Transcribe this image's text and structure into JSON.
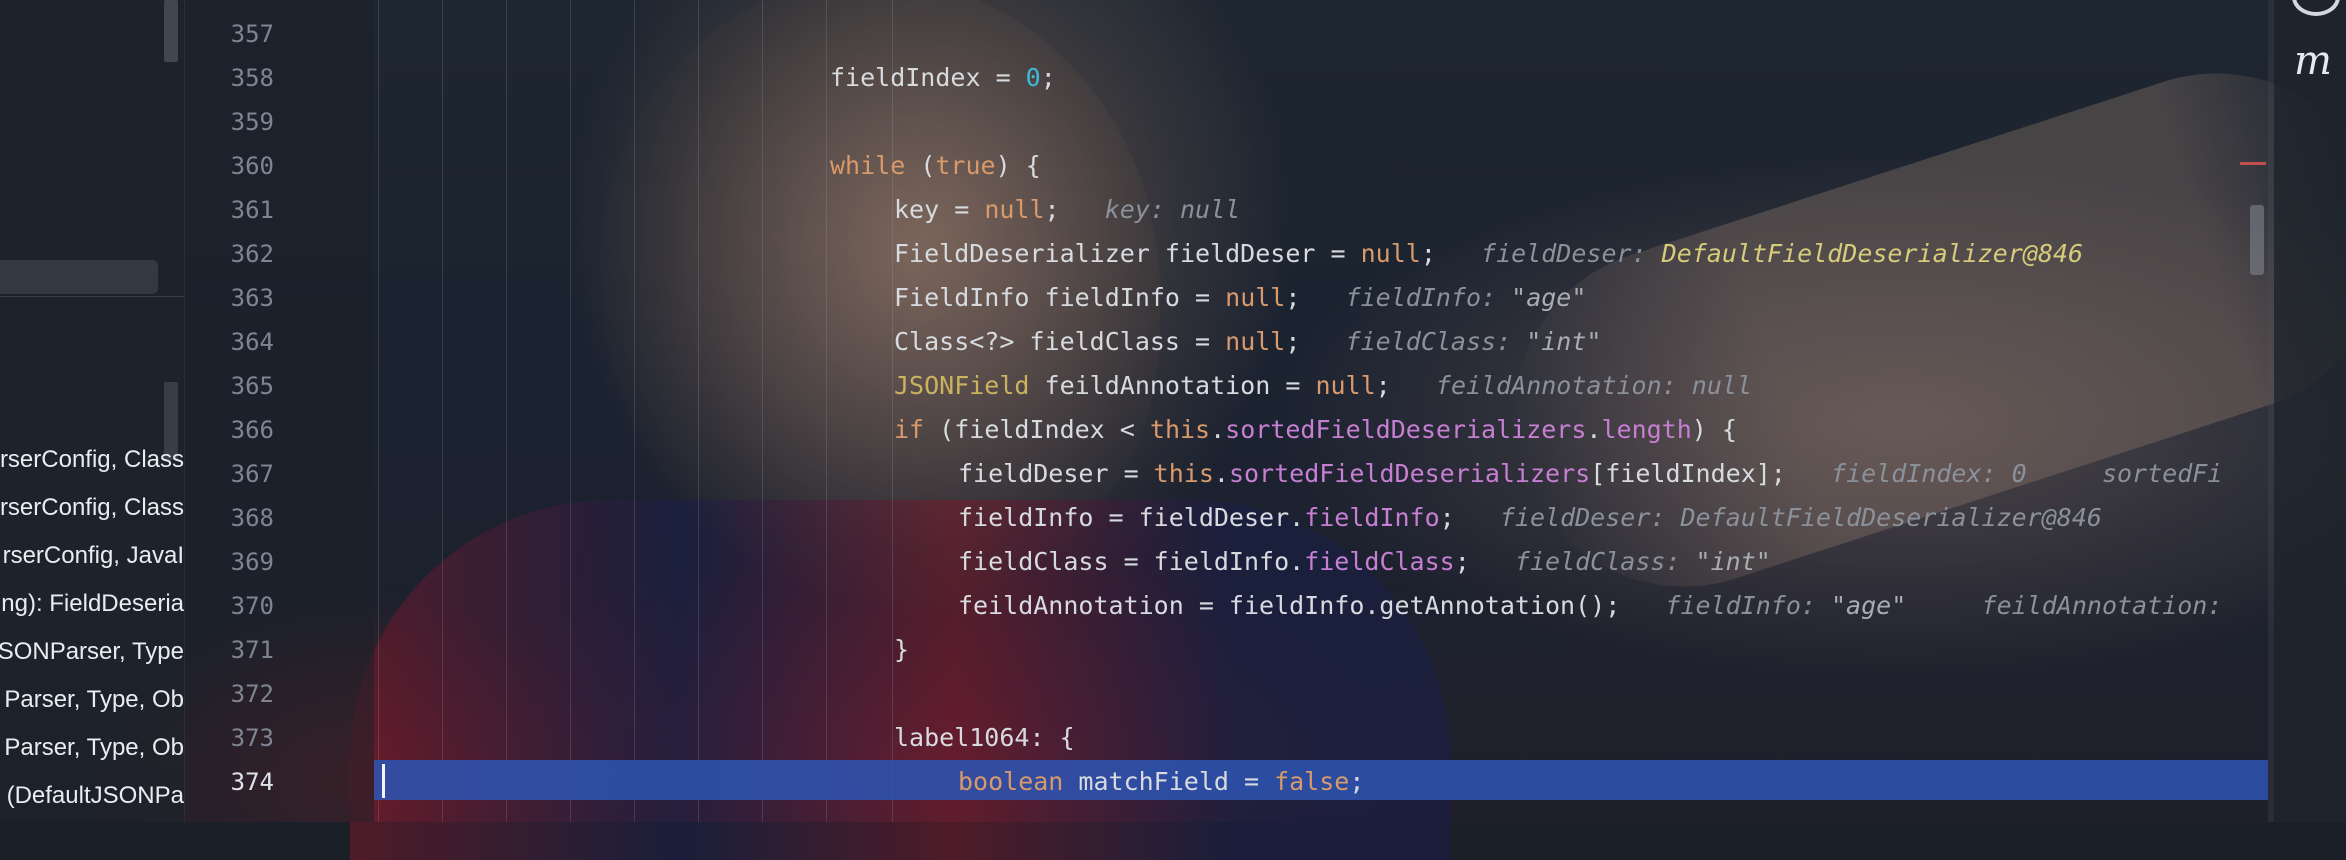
{
  "frames": [
    {
      "label": "rserConfig, Class"
    },
    {
      "label": "rserConfig, Class"
    },
    {
      "label": "rserConfig, JavaI"
    },
    {
      "label": "ng): FieldDeseria"
    },
    {
      "label": "SONParser, Type"
    },
    {
      "label": "Parser, Type, Ob"
    },
    {
      "label": "Parser, Type, Ob"
    },
    {
      "label": "(DefaultJSONPa"
    }
  ],
  "gutter": {
    "line_numbers": [
      "357",
      "358",
      "359",
      "360",
      "361",
      "362",
      "363",
      "364",
      "365",
      "366",
      "367",
      "368",
      "369",
      "370",
      "371",
      "372",
      "373",
      "374"
    ],
    "current_line": "374"
  },
  "code": {
    "l358": {
      "a": "fieldIndex = ",
      "b": "0",
      "c": ";"
    },
    "l360": {
      "kw": "while",
      "a": " (",
      "b": "true",
      "c": ") {"
    },
    "l361": {
      "a": "key = ",
      "b": "null",
      "c": ";",
      "hint": "key: null"
    },
    "l362": {
      "a": "FieldDeserializer fieldDeser = ",
      "b": "null",
      "c": ";",
      "hint_label": "fieldDeser: ",
      "hint_obj": "DefaultFieldDeserializer@846"
    },
    "l363": {
      "a": "FieldInfo fieldInfo = ",
      "b": "null",
      "c": ";",
      "hint_label": "fieldInfo: ",
      "hint_val": "\"age\""
    },
    "l364": {
      "a": "Class<?> fieldClass = ",
      "b": "null",
      "c": ";",
      "hint_label": "fieldClass: ",
      "hint_val": "\"int\""
    },
    "l365": {
      "anno": "JSONField",
      "a": " feildAnnotation = ",
      "b": "null",
      "c": ";",
      "hint": "feildAnnotation: null"
    },
    "l366": {
      "kw": "if",
      "a": " (fieldIndex < ",
      "b": "this",
      "c": ".",
      "f1": "sortedFieldDeserializers",
      "d": ".",
      "f2": "length",
      "e": ") {"
    },
    "l367": {
      "a": "fieldDeser = ",
      "b": "this",
      "c": ".",
      "f1": "sortedFieldDeserializers",
      "d": "[fieldIndex];",
      "hint1": "fieldIndex: 0",
      "hint2": "sortedFi"
    },
    "l368": {
      "a": "fieldInfo = fieldDeser.",
      "f1": "fieldInfo",
      "c": ";",
      "hint_label": "fieldDeser: ",
      "hint_obj": "DefaultFieldDeserializer@846"
    },
    "l369": {
      "a": "fieldClass = fieldInfo.",
      "f1": "fieldClass",
      "c": ";",
      "hint_label": "fieldClass: ",
      "hint_val": "\"int\""
    },
    "l370": {
      "a": "feildAnnotation = fieldInfo.getAnnotation();",
      "hint_label": "fieldInfo: ",
      "hint_val": "\"age\"",
      "hint2": "feildAnnotation:"
    },
    "l371": {
      "a": "}"
    },
    "l373": {
      "a": "label1064: {"
    },
    "l374": {
      "kw": "boolean",
      "a": " matchField = ",
      "b": "false",
      "c": ";"
    }
  },
  "right_strip": {
    "icon": "m"
  },
  "colors": {
    "current_line": "#2d53af",
    "keyword": "#d99a6b",
    "number": "#3fb9d5",
    "field": "#c67fd3",
    "annotation": "#c9b35f"
  }
}
